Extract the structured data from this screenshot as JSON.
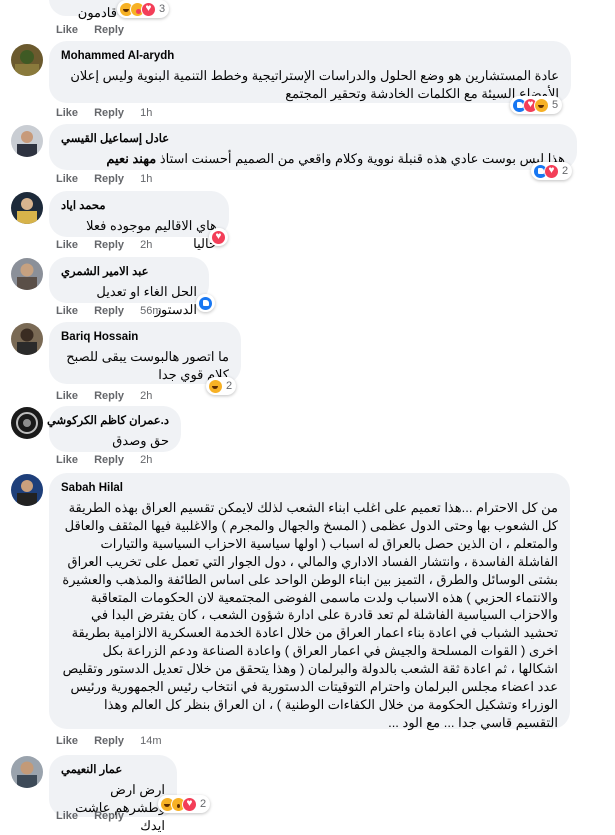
{
  "labels": {
    "like": "Like",
    "reply": "Reply"
  },
  "comments": [
    {
      "author": "",
      "text": "قادمون",
      "time": "",
      "reactions": {
        "icons": [
          "haha",
          "care",
          "love"
        ],
        "count": "3"
      }
    },
    {
      "author": "Mohammed Al-arydh",
      "text": "عادة المستشارين هو وضع الحلول والدراسات الإستراتيجية وخطط التنمية البنوية وليس إعلان الأوضاع السيئة مع الكلمات الخادشة وتحقير المجتمع",
      "time": "1h",
      "reactions": {
        "icons": [
          "like",
          "love",
          "haha"
        ],
        "count": "5"
      }
    },
    {
      "author": "عادل إسماعيل القيسي",
      "text": "هذا ليس بوست عادي هذه قنبلة نووية وكلام واقعي من الصميم أحسنت استاذ",
      "mention": "مهند نعيم",
      "time": "1h",
      "reactions": {
        "icons": [
          "like",
          "love"
        ],
        "count": "2"
      }
    },
    {
      "author": "محمد اياد",
      "text": "هاي الاقاليم موجوده فعلا حاليا",
      "time": "2h",
      "reactions": {
        "icons": [
          "love"
        ],
        "count": ""
      }
    },
    {
      "author": "عبد الامير الشمري",
      "text": "الحل الغاء او تعديل الدستور",
      "time": "56m",
      "reactions": {
        "icons": [
          "like"
        ],
        "count": ""
      }
    },
    {
      "author": "Bariq Hossain",
      "text": "ما اتصور هالبوست يبقى للصبح كلام قوي جدا",
      "time": "2h",
      "reactions": {
        "icons": [
          "haha"
        ],
        "count": "2"
      }
    },
    {
      "author": "د.عمران كاظم الكركوشي",
      "text": "حق وصدق",
      "time": "2h",
      "reactions": null
    },
    {
      "author": "Sabah Hilal",
      "text": "من كل الاحترام ...هذا تعميم على اغلب ابناء الشعب لذلك لايمكن تقسيم العراق بهذه الطريقة كل الشعوب بها وحتى الدول عظمى ( المسخ والجهال والمجرم ) والاغلبية فيها المثقف والعاقل والمتعلم ، ان الذين حصل بالعراق له اسباب ( اولها سياسية الاحزاب السياسية والتيارات الفاشلة الفاسدة ، وانتشار الفساد الاداري والمالي ، دول الجوار التي تعمل على تخريب العراق بشتى الوسائل والطرق ، التميز بين ابناء الوطن الواحد على اساس الطائفة والمذهب والعشيرة والانتماء الحزبي ) هذه الاسباب ولدت ماسمى الفوضى المجتمعية لان الحكومات المتعاقبة والاحزاب السياسية الفاشلة لم تعد قادرة على ادارة شؤون الشعب ، كان يفترض البدا في تحشيد الشباب في اعادة بناء اعمار العراق من خلال اعادة الخدمة العسكرية الالزامية بطريقة اخرى ( القوات المسلحة والجيش في اعمار العراق ) واعادة الصناعة ودعم الزراعة بكل اشكالها ، ثم اعادة ثقة الشعب بالدولة والبرلمان ( وهذا يتحقق من خلال تعديل الدستور وتقليص عدد اعضاء مجلس البرلمان واحترام التوقيتات الدستورية في انتخاب رئيس الجمهورية ورئيس الوزراء وتشكيل الحكومة من خلال الكفاءات الوطنية ) ، ان العراق بنظر كل العالم وهذا التقسيم قاسي جدا ... مع الود ...",
      "time": "14m",
      "reactions": null
    },
    {
      "author": "عمار النعيمي",
      "text": "ارض ارض وطشرهم عاشت ايدك",
      "time": "",
      "reactions": {
        "icons": [
          "haha",
          "wow",
          "love"
        ],
        "count": "2"
      }
    }
  ]
}
